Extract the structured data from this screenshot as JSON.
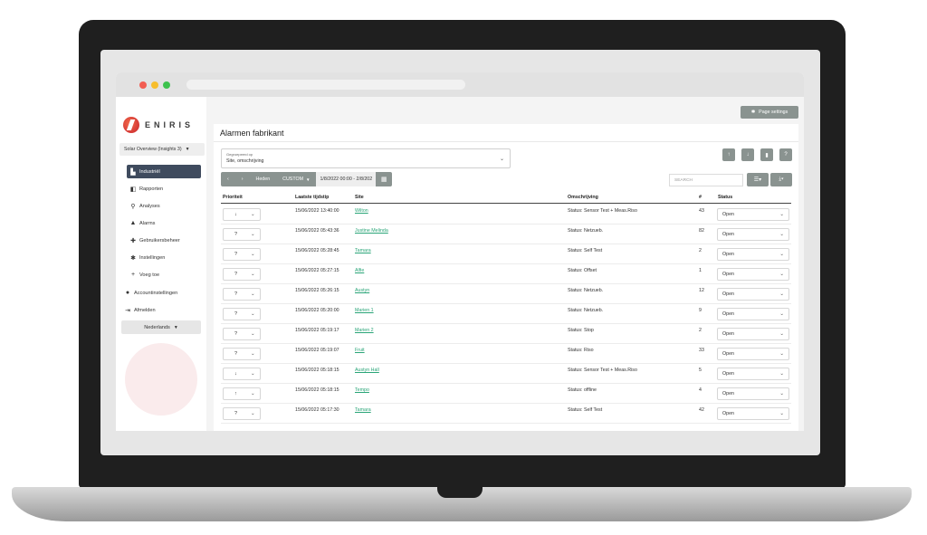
{
  "brand": {
    "logo_text": "ENIRIS",
    "accent": "#c8232c",
    "link_color": "#2aa578",
    "button_color": "#8a9390"
  },
  "sidebar": {
    "environment": "Solar Overview (Insights 3)",
    "items": [
      {
        "label": "Industriël",
        "icon": "factory-icon",
        "active": true
      },
      {
        "label": "Rapporten",
        "icon": "report-icon"
      },
      {
        "label": "Analyses",
        "icon": "search-icon"
      },
      {
        "label": "Alarms",
        "icon": "bell-icon"
      },
      {
        "label": "Gebruikersbeheer",
        "icon": "user-plus-icon"
      },
      {
        "label": "Instellingen",
        "icon": "gear-icon"
      },
      {
        "label": "Voeg toe",
        "icon": "plus-icon"
      }
    ],
    "account_items": [
      {
        "label": "Accountinstellingen",
        "icon": "user-icon"
      },
      {
        "label": "Afmelden",
        "icon": "logout-icon"
      }
    ],
    "language": "Nederlands"
  },
  "header": {
    "page_settings": "Page settings"
  },
  "card": {
    "title": "Alarmen fabrikant",
    "group_by_label": "Gegroepeerd op",
    "group_by_value": "Site, omschrijving"
  },
  "toolbar": {
    "prev": "‹",
    "next": "›",
    "today": "Heden",
    "range_mode": "CUSTOM",
    "range": "1/8/2022 00:00 - 2/8/202"
  },
  "search": {
    "placeholder": "SEARCH"
  },
  "table": {
    "headers": {
      "priority": "Prioriteit",
      "timestamp": "Laatste tijdstip",
      "site": "Site",
      "description": "Omschrijving",
      "count": "#",
      "status": "Status"
    },
    "rows": [
      {
        "prio": "↓",
        "time": "15/06/2022 13:40:00",
        "site": "Wilton",
        "desc": "Status: Sensor Test + Meas.Riso",
        "count": "43",
        "status": "Open"
      },
      {
        "prio": "?",
        "time": "15/06/2022 05:43:36",
        "site": "Justine Melinda",
        "desc": "Status: Netzueb.",
        "count": "82",
        "status": "Open"
      },
      {
        "prio": "?",
        "time": "15/06/2022 05:28:45",
        "site": "Tamara",
        "desc": "Status: Self Test",
        "count": "2",
        "status": "Open"
      },
      {
        "prio": "?",
        "time": "15/06/2022 05:27:15",
        "site": "Alfie",
        "desc": "Status: Offset",
        "count": "1",
        "status": "Open"
      },
      {
        "prio": "?",
        "time": "15/06/2022 05:26:15",
        "site": "Austyn",
        "desc": "Status: Netzueb.",
        "count": "12",
        "status": "Open"
      },
      {
        "prio": "?",
        "time": "15/06/2022 05:20:00",
        "site": "Marien 1",
        "desc": "Status: Netzueb.",
        "count": "9",
        "status": "Open"
      },
      {
        "prio": "?",
        "time": "15/06/2022 05:19:17",
        "site": "Marien 2",
        "desc": "Status: Stop",
        "count": "2",
        "status": "Open"
      },
      {
        "prio": "?",
        "time": "15/06/2022 05:19:07",
        "site": "Fruit",
        "desc": "Status: Riso",
        "count": "33",
        "status": "Open"
      },
      {
        "prio": "↓",
        "time": "15/06/2022 05:18:15",
        "site": "Austyn Hall",
        "desc": "Status: Sensor Test + Meas.Riso",
        "count": "5",
        "status": "Open"
      },
      {
        "prio": "↑",
        "time": "15/06/2022 05:18:15",
        "site": "Tempo",
        "desc": "Status: offline",
        "count": "4",
        "status": "Open"
      },
      {
        "prio": "?",
        "time": "15/06/2022 05:17:30",
        "site": "Tamara",
        "desc": "Status: Self Test",
        "count": "42",
        "status": "Open"
      }
    ]
  }
}
